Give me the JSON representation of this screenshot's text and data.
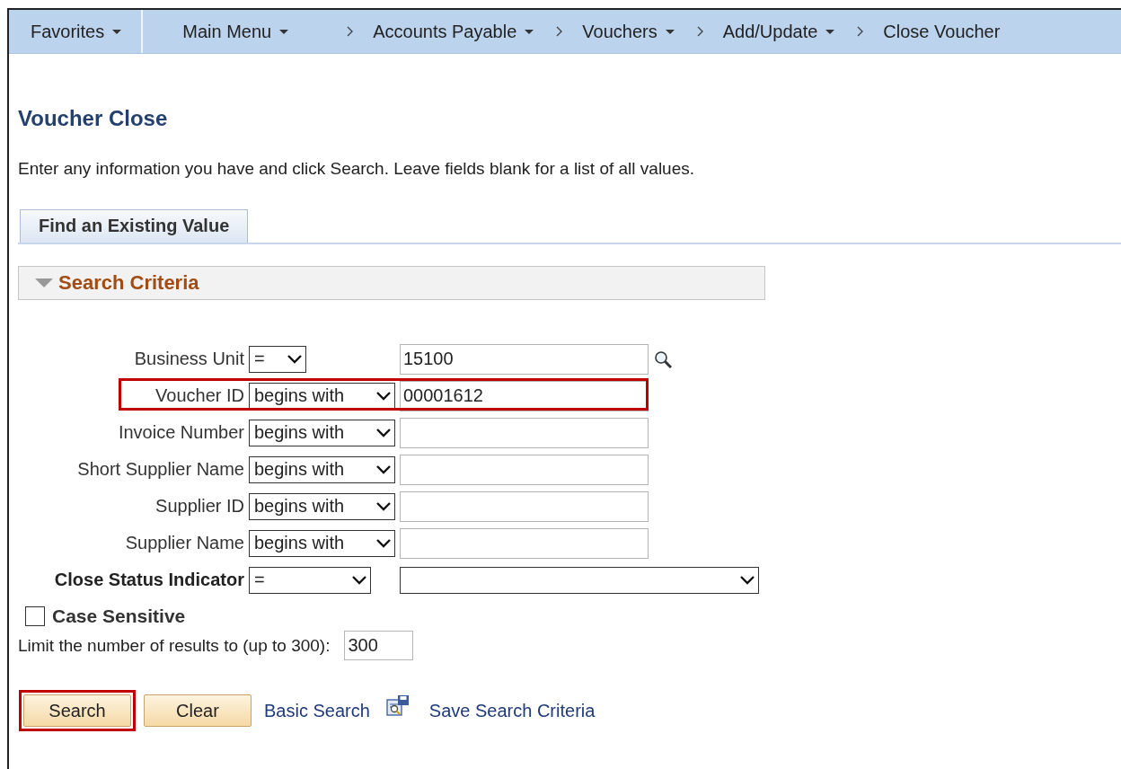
{
  "nav": {
    "items": [
      {
        "label": "Favorites",
        "dropdown": true,
        "chevron": false,
        "divider": true
      },
      {
        "label": "Main Menu",
        "dropdown": true,
        "chevron": false,
        "divider": false
      },
      {
        "label": "Accounts Payable",
        "dropdown": true,
        "chevron": true,
        "divider": false
      },
      {
        "label": "Vouchers",
        "dropdown": true,
        "chevron": true,
        "divider": false
      },
      {
        "label": "Add/Update",
        "dropdown": true,
        "chevron": true,
        "divider": false
      },
      {
        "label": "Close Voucher",
        "dropdown": false,
        "chevron": true,
        "divider": false
      }
    ]
  },
  "page": {
    "title": "Voucher Close",
    "instructions": "Enter any information you have and click Search. Leave fields blank for a list of all values."
  },
  "tabs": [
    {
      "label": "Find an Existing Value",
      "selected": true
    }
  ],
  "search_criteria": {
    "title": "Search Criteria",
    "expanded": true,
    "rows": [
      {
        "kind": "key",
        "label": "Business Unit",
        "operator": "=",
        "value": "15100"
      },
      {
        "kind": "text",
        "label": "Voucher ID",
        "operator": "begins with",
        "value": "00001612",
        "highlighted": true
      },
      {
        "kind": "text",
        "label": "Invoice Number",
        "operator": "begins with"
      },
      {
        "kind": "text",
        "label": "Short Supplier Name",
        "operator": "begins with"
      },
      {
        "kind": "text",
        "label": "Supplier ID",
        "operator": "begins with"
      },
      {
        "kind": "text",
        "label": "Supplier Name",
        "operator": "begins with"
      },
      {
        "kind": "select",
        "label": "Close Status Indicator",
        "operator": "="
      }
    ],
    "case_sensitive": {
      "label": "Case Sensitive",
      "checked": false
    },
    "limit": {
      "label": "Limit the number of results to (up to 300):",
      "value": "300"
    }
  },
  "buttons": [
    {
      "label": "Search",
      "highlighted": true
    },
    {
      "label": "Clear"
    }
  ],
  "links": [
    {
      "kind": "plain",
      "label": "Basic Search"
    },
    {
      "kind": "save",
      "label": "Save Search Criteria"
    }
  ]
}
